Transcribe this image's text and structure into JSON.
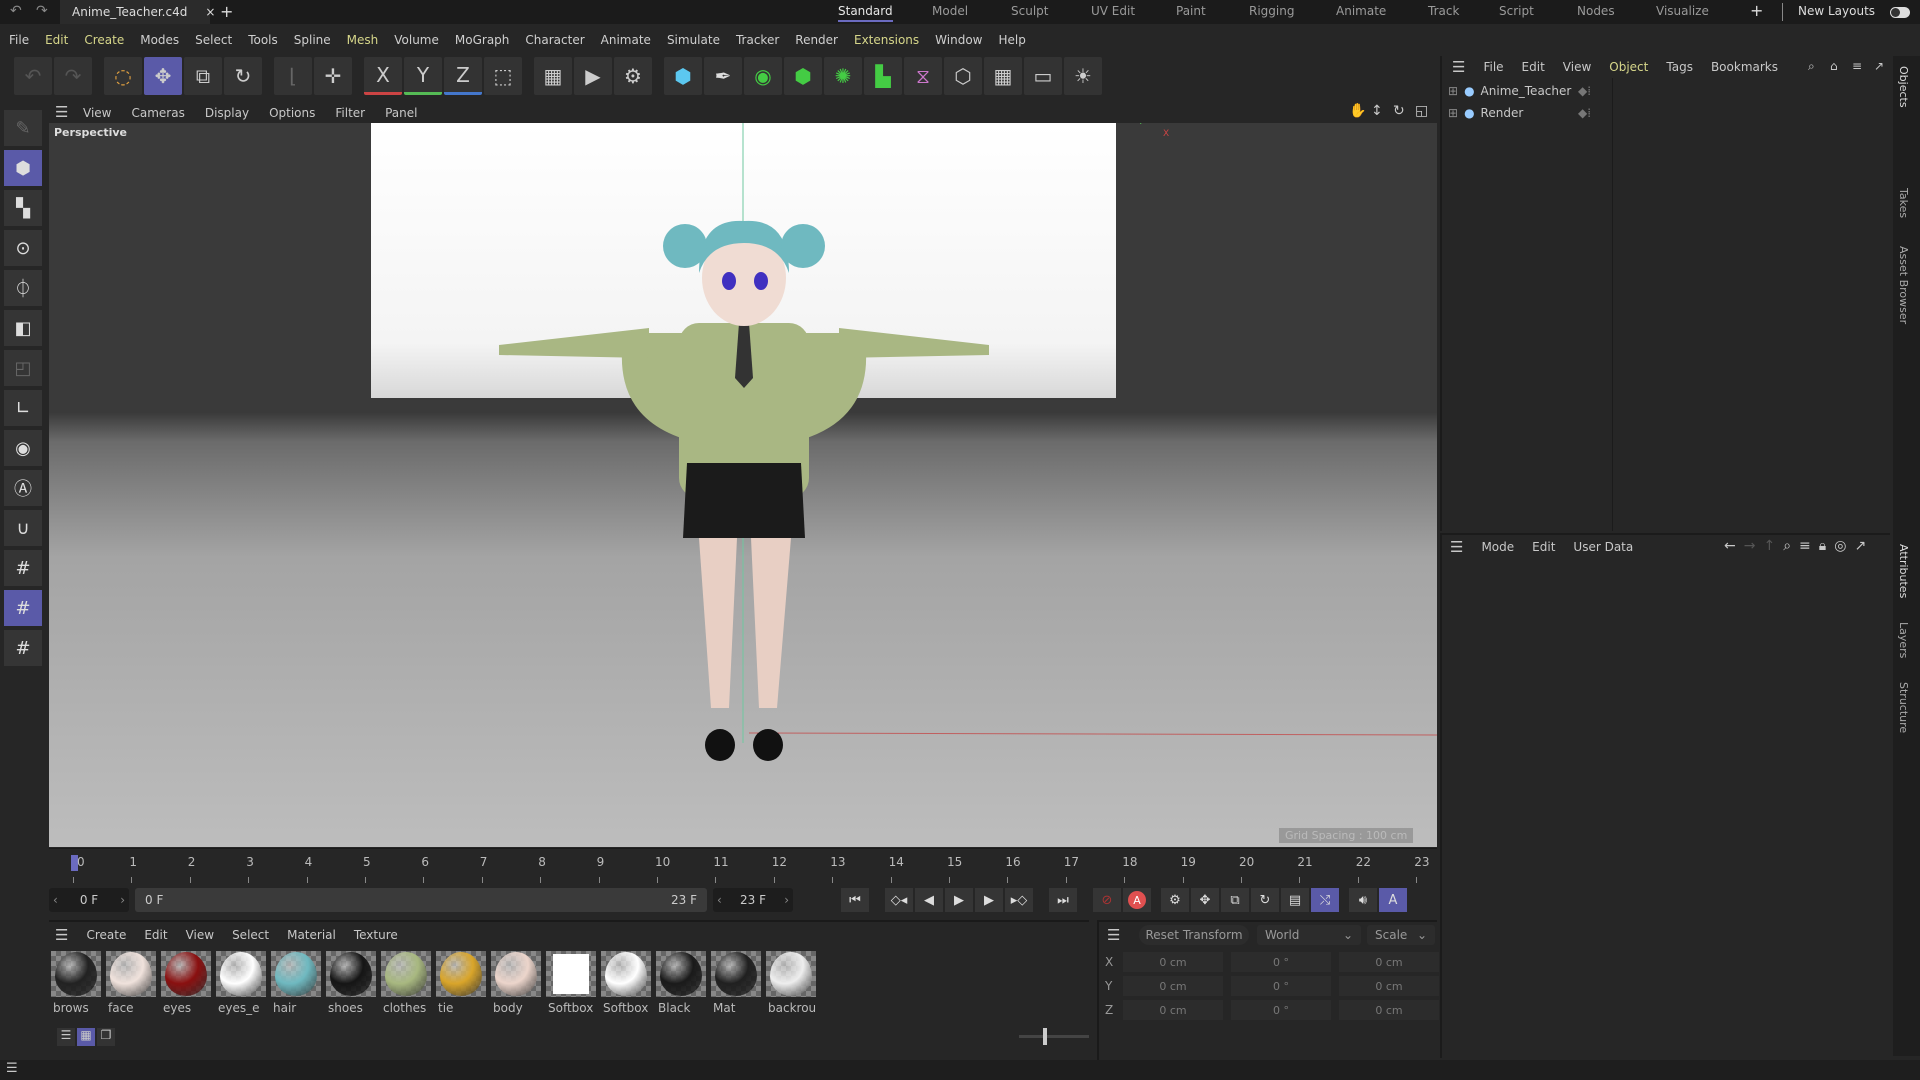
{
  "titlebar": {
    "doc_name": "Anime_Teacher.c4d",
    "close": "×",
    "new_tab": "+",
    "layouts": [
      "Standard",
      "Model",
      "Sculpt",
      "UV Edit",
      "Paint",
      "Rigging",
      "Animate",
      "Track",
      "Script",
      "Nodes",
      "Visualize"
    ],
    "active_layout": "Standard",
    "add_layout": "+",
    "new_layouts": "New Layouts"
  },
  "menu": [
    "File",
    "Edit",
    "Create",
    "Modes",
    "Select",
    "Tools",
    "Spline",
    "Mesh",
    "Volume",
    "MoGraph",
    "Character",
    "Animate",
    "Simulate",
    "Tracker",
    "Render",
    "Extensions",
    "Window",
    "Help"
  ],
  "toolbar": {
    "x": "X",
    "y": "Y",
    "z": "Z"
  },
  "viewport": {
    "menu": [
      "View",
      "Cameras",
      "Display",
      "Options",
      "Filter",
      "Panel"
    ],
    "camera": "Perspective",
    "grid_spacing": "Grid Spacing : 100 cm",
    "axis_y": "Y",
    "axis_x": "X"
  },
  "objects": {
    "menu": [
      "File",
      "Edit",
      "View",
      "Object",
      "Tags",
      "Bookmarks"
    ],
    "items": [
      "Anime_Teacher",
      "Render"
    ]
  },
  "attributes": {
    "menu": [
      "Mode",
      "Edit",
      "User Data"
    ]
  },
  "side_tabs": [
    "Objects",
    "Takes",
    "Asset Browser",
    "Attributes",
    "Layers",
    "Structure"
  ],
  "timeline": {
    "frames": [
      "0",
      "1",
      "2",
      "3",
      "4",
      "5",
      "6",
      "7",
      "8",
      "9",
      "10",
      "11",
      "12",
      "13",
      "14",
      "15",
      "16",
      "17",
      "18",
      "19",
      "20",
      "21",
      "22",
      "23"
    ],
    "current": "0 F",
    "range_start": "0 F",
    "range_end": "23 F",
    "end": "23 F",
    "auto_key": "A"
  },
  "materials": {
    "menu": [
      "Create",
      "Edit",
      "View",
      "Select",
      "Material",
      "Texture"
    ],
    "items": [
      {
        "name": "brows",
        "color": "#222"
      },
      {
        "name": "face",
        "color": "#f0e2dc"
      },
      {
        "name": "eyes",
        "color": "#8a1010"
      },
      {
        "name": "eyes_e",
        "color": "#ffffff"
      },
      {
        "name": "hair",
        "color": "#6fb9c0"
      },
      {
        "name": "shoes",
        "color": "#151515"
      },
      {
        "name": "clothes",
        "color": "#a8b880"
      },
      {
        "name": "tie",
        "color": "#d9a52a"
      },
      {
        "name": "body",
        "color": "#ecd5cb"
      },
      {
        "name": "Softbox",
        "color": "#ffffff"
      },
      {
        "name": "Softbox",
        "color": "#ffffff"
      },
      {
        "name": "Black",
        "color": "#1a1a1a"
      },
      {
        "name": "Mat",
        "color": "#202020"
      },
      {
        "name": "backrou",
        "color": "#eeeeee"
      }
    ]
  },
  "coordinates": {
    "reset": "Reset Transform",
    "space": "World",
    "mode": "Scale",
    "rows": [
      {
        "axis": "X",
        "pos": "0 cm",
        "rot": "0 °",
        "scale": "0 cm"
      },
      {
        "axis": "Y",
        "pos": "0 cm",
        "rot": "0 °",
        "scale": "0 cm"
      },
      {
        "axis": "Z",
        "pos": "0 cm",
        "rot": "0 °",
        "scale": "0 cm"
      }
    ]
  },
  "colors": {
    "accent": "#5a5aa8",
    "highlight_menu": "#d6d68a"
  }
}
